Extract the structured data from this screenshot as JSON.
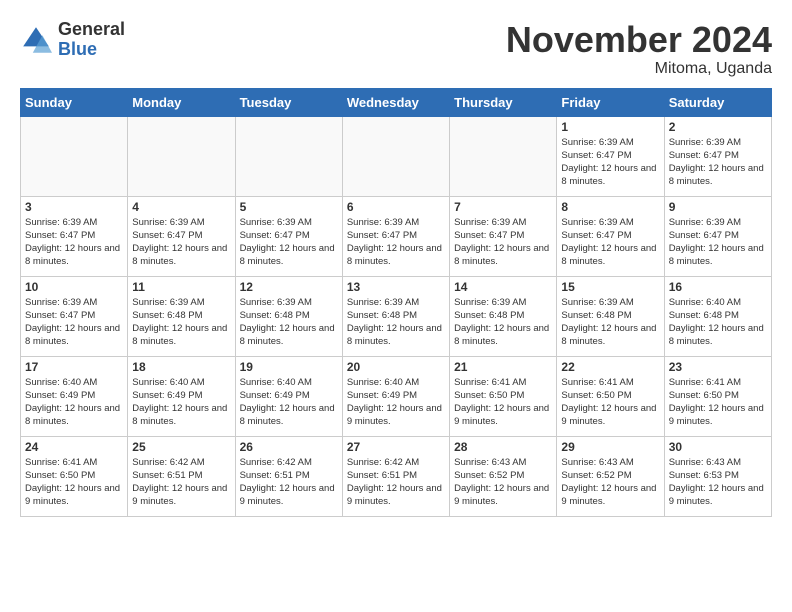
{
  "logo": {
    "general": "General",
    "blue": "Blue"
  },
  "title": "November 2024",
  "location": "Mitoma, Uganda",
  "headers": [
    "Sunday",
    "Monday",
    "Tuesday",
    "Wednesday",
    "Thursday",
    "Friday",
    "Saturday"
  ],
  "weeks": [
    [
      {
        "day": "",
        "info": ""
      },
      {
        "day": "",
        "info": ""
      },
      {
        "day": "",
        "info": ""
      },
      {
        "day": "",
        "info": ""
      },
      {
        "day": "",
        "info": ""
      },
      {
        "day": "1",
        "info": "Sunrise: 6:39 AM\nSunset: 6:47 PM\nDaylight: 12 hours and 8 minutes."
      },
      {
        "day": "2",
        "info": "Sunrise: 6:39 AM\nSunset: 6:47 PM\nDaylight: 12 hours and 8 minutes."
      }
    ],
    [
      {
        "day": "3",
        "info": "Sunrise: 6:39 AM\nSunset: 6:47 PM\nDaylight: 12 hours and 8 minutes."
      },
      {
        "day": "4",
        "info": "Sunrise: 6:39 AM\nSunset: 6:47 PM\nDaylight: 12 hours and 8 minutes."
      },
      {
        "day": "5",
        "info": "Sunrise: 6:39 AM\nSunset: 6:47 PM\nDaylight: 12 hours and 8 minutes."
      },
      {
        "day": "6",
        "info": "Sunrise: 6:39 AM\nSunset: 6:47 PM\nDaylight: 12 hours and 8 minutes."
      },
      {
        "day": "7",
        "info": "Sunrise: 6:39 AM\nSunset: 6:47 PM\nDaylight: 12 hours and 8 minutes."
      },
      {
        "day": "8",
        "info": "Sunrise: 6:39 AM\nSunset: 6:47 PM\nDaylight: 12 hours and 8 minutes."
      },
      {
        "day": "9",
        "info": "Sunrise: 6:39 AM\nSunset: 6:47 PM\nDaylight: 12 hours and 8 minutes."
      }
    ],
    [
      {
        "day": "10",
        "info": "Sunrise: 6:39 AM\nSunset: 6:47 PM\nDaylight: 12 hours and 8 minutes."
      },
      {
        "day": "11",
        "info": "Sunrise: 6:39 AM\nSunset: 6:48 PM\nDaylight: 12 hours and 8 minutes."
      },
      {
        "day": "12",
        "info": "Sunrise: 6:39 AM\nSunset: 6:48 PM\nDaylight: 12 hours and 8 minutes."
      },
      {
        "day": "13",
        "info": "Sunrise: 6:39 AM\nSunset: 6:48 PM\nDaylight: 12 hours and 8 minutes."
      },
      {
        "day": "14",
        "info": "Sunrise: 6:39 AM\nSunset: 6:48 PM\nDaylight: 12 hours and 8 minutes."
      },
      {
        "day": "15",
        "info": "Sunrise: 6:39 AM\nSunset: 6:48 PM\nDaylight: 12 hours and 8 minutes."
      },
      {
        "day": "16",
        "info": "Sunrise: 6:40 AM\nSunset: 6:48 PM\nDaylight: 12 hours and 8 minutes."
      }
    ],
    [
      {
        "day": "17",
        "info": "Sunrise: 6:40 AM\nSunset: 6:49 PM\nDaylight: 12 hours and 8 minutes."
      },
      {
        "day": "18",
        "info": "Sunrise: 6:40 AM\nSunset: 6:49 PM\nDaylight: 12 hours and 8 minutes."
      },
      {
        "day": "19",
        "info": "Sunrise: 6:40 AM\nSunset: 6:49 PM\nDaylight: 12 hours and 8 minutes."
      },
      {
        "day": "20",
        "info": "Sunrise: 6:40 AM\nSunset: 6:49 PM\nDaylight: 12 hours and 9 minutes."
      },
      {
        "day": "21",
        "info": "Sunrise: 6:41 AM\nSunset: 6:50 PM\nDaylight: 12 hours and 9 minutes."
      },
      {
        "day": "22",
        "info": "Sunrise: 6:41 AM\nSunset: 6:50 PM\nDaylight: 12 hours and 9 minutes."
      },
      {
        "day": "23",
        "info": "Sunrise: 6:41 AM\nSunset: 6:50 PM\nDaylight: 12 hours and 9 minutes."
      }
    ],
    [
      {
        "day": "24",
        "info": "Sunrise: 6:41 AM\nSunset: 6:50 PM\nDaylight: 12 hours and 9 minutes."
      },
      {
        "day": "25",
        "info": "Sunrise: 6:42 AM\nSunset: 6:51 PM\nDaylight: 12 hours and 9 minutes."
      },
      {
        "day": "26",
        "info": "Sunrise: 6:42 AM\nSunset: 6:51 PM\nDaylight: 12 hours and 9 minutes."
      },
      {
        "day": "27",
        "info": "Sunrise: 6:42 AM\nSunset: 6:51 PM\nDaylight: 12 hours and 9 minutes."
      },
      {
        "day": "28",
        "info": "Sunrise: 6:43 AM\nSunset: 6:52 PM\nDaylight: 12 hours and 9 minutes."
      },
      {
        "day": "29",
        "info": "Sunrise: 6:43 AM\nSunset: 6:52 PM\nDaylight: 12 hours and 9 minutes."
      },
      {
        "day": "30",
        "info": "Sunrise: 6:43 AM\nSunset: 6:53 PM\nDaylight: 12 hours and 9 minutes."
      }
    ]
  ]
}
